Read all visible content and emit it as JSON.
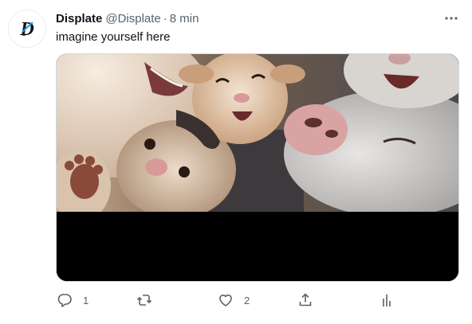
{
  "tweet": {
    "display_name": "Displate",
    "handle": "@Displate",
    "separator": "·",
    "time": "8 min",
    "text": "imagine yourself here",
    "avatar": {
      "icon": "displate-logo-icon",
      "letter": "D"
    },
    "more_icon": "more-horizontal-icon",
    "media": {
      "description_icon": "animal-selfie-image"
    }
  },
  "actions": {
    "reply": {
      "icon": "reply-icon",
      "count": "1"
    },
    "retweet": {
      "icon": "retweet-icon",
      "count": ""
    },
    "like": {
      "icon": "heart-icon",
      "count": "2"
    },
    "share": {
      "icon": "share-icon"
    },
    "analytics": {
      "icon": "analytics-icon"
    }
  },
  "colors": {
    "text_primary": "#0f1419",
    "text_secondary": "#536471",
    "border": "#cfd9de",
    "brand_blue": "#1d9bf0"
  }
}
